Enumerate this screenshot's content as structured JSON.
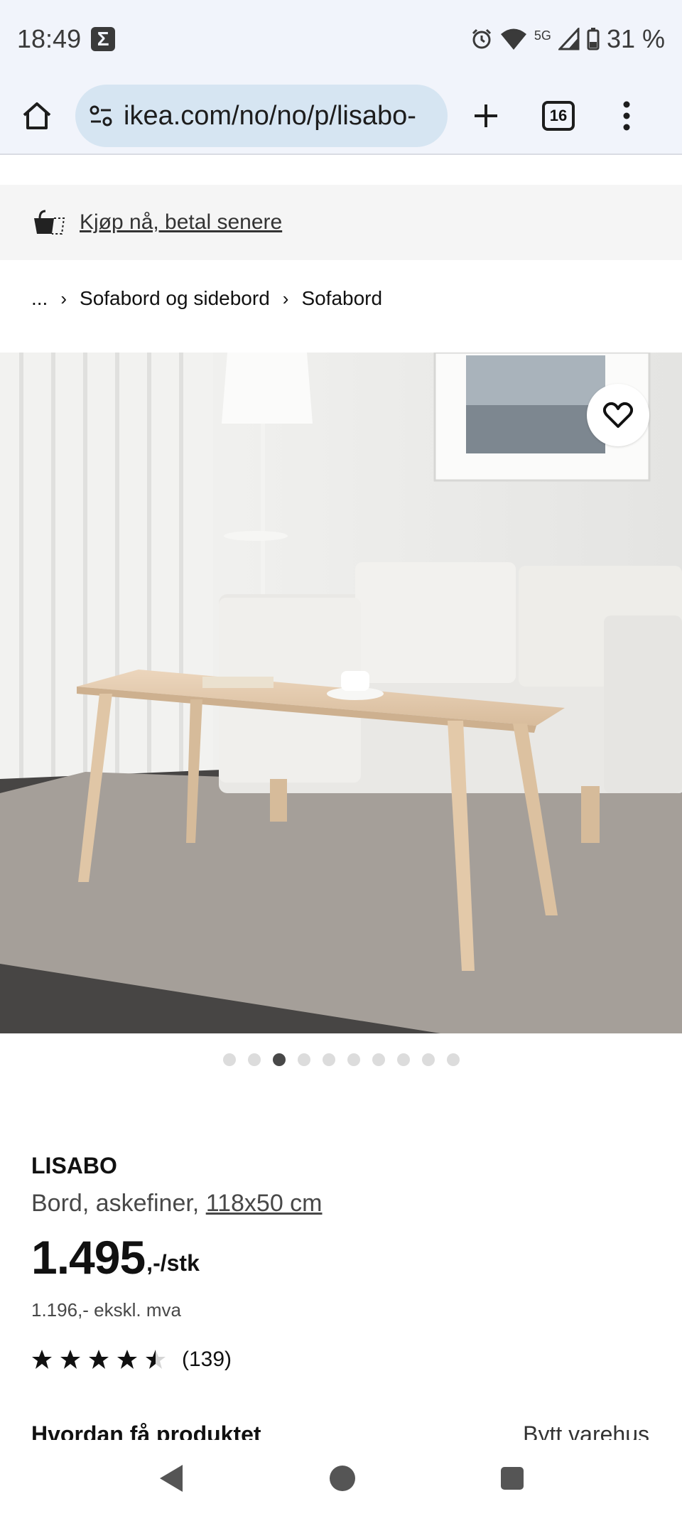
{
  "status": {
    "time": "18:49",
    "sigma_badge": "Σ",
    "network": "5G",
    "battery": "31 %"
  },
  "browser": {
    "url": "ikea.com/no/no/p/lisabo-",
    "tab_count": "16"
  },
  "banner": {
    "pay_later": "Kjøp nå, betal senere"
  },
  "breadcrumb": {
    "ellipsis": "...",
    "items": [
      "Sofabord og sidebord",
      "Sofabord"
    ]
  },
  "gallery": {
    "current": 3,
    "total": 10
  },
  "product": {
    "name": "LISABO",
    "description": "Bord, askefiner,",
    "size": "118x50 cm",
    "price": "1.495",
    "price_suffix": ",-/stk",
    "price_ex_vat": "1.196,- ekskl. mva",
    "rating_value": 4.5,
    "rating_count": "(139)"
  },
  "delivery": {
    "title": "Hvordan få produktet",
    "change_store": "Bytt varehus"
  },
  "colors": {
    "url_pill": "#d6e5f2",
    "chrome_bg": "#f1f4fb"
  }
}
